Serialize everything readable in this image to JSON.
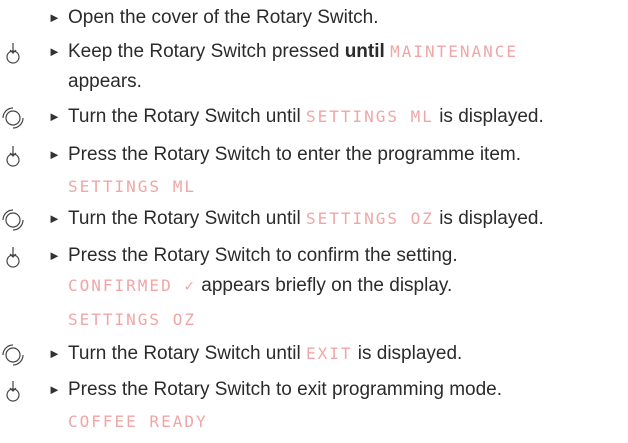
{
  "steps": [
    {
      "icon": "none",
      "text_before": "Open the cover of the Rotary Switch.",
      "display": "",
      "text_after": ""
    },
    {
      "icon": "press-icon",
      "text_before": "Keep the Rotary Switch pressed ",
      "bold": "until",
      "display": "MAINTENANCE",
      "text_after": "",
      "cont": "appears."
    },
    {
      "icon": "turn-icon",
      "text_before": "Turn the Rotary Switch until ",
      "display": "SETTINGS ML",
      "text_after": " is displayed."
    },
    {
      "icon": "press-icon",
      "text_before": "Press the Rotary Switch to enter the programme item.",
      "display_line": "SETTINGS ML"
    },
    {
      "icon": "turn-icon",
      "text_before": "Turn the Rotary Switch until ",
      "display": "SETTINGS OZ",
      "text_after": " is displayed."
    },
    {
      "icon": "press-icon",
      "text_before": "Press the Rotary Switch to confirm the setting.",
      "confirm_display": "CONFIRMED ✓",
      "confirm_text": " appears briefly on the display.",
      "display_line": "SETTINGS OZ"
    },
    {
      "icon": "turn-icon",
      "text_before": "Turn the Rotary Switch until ",
      "display": "EXIT",
      "text_after": " is displayed."
    },
    {
      "icon": "press-icon",
      "text_before": "Press the Rotary Switch to exit programming mode.",
      "display_line": "COFFEE READY"
    }
  ],
  "colors": {
    "display_text": "#f0a6a6",
    "body_text": "#2b2b2b"
  }
}
